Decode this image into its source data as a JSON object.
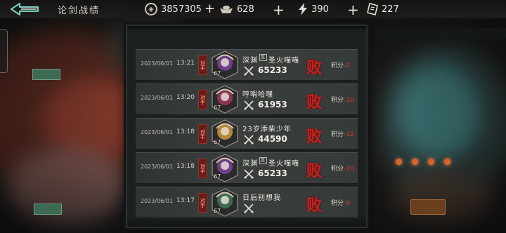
{
  "header": {
    "title": "论剑战绩",
    "resources": {
      "coins": "3857305",
      "ingots": "628",
      "energy": "390",
      "tickets": "227"
    }
  },
  "records": [
    {
      "date": "2023/06/01",
      "time": "13:21",
      "tag": "对手",
      "level": "67",
      "name": "深渊",
      "badge": "区",
      "name_suffix": "圣火喵喵",
      "power": "65233",
      "result": "败",
      "score_label": "积分",
      "score_delta": "-2",
      "avatar_color": "#6f3f8a"
    },
    {
      "date": "2023/06/01",
      "time": "13:20",
      "tag": "对手",
      "level": "67",
      "name": "哼哨哈嘿",
      "badge": "",
      "name_suffix": "",
      "power": "61953",
      "result": "败",
      "score_label": "积分",
      "score_delta": "-10",
      "avatar_color": "#8a3454"
    },
    {
      "date": "2023/06/01",
      "time": "13:18",
      "tag": "对手",
      "level": "67",
      "name": "23岁添柴少年",
      "badge": "",
      "name_suffix": "",
      "power": "44590",
      "result": "败",
      "score_label": "积分",
      "score_delta": "-12",
      "avatar_color": "#b2893a"
    },
    {
      "date": "2023/06/01",
      "time": "13:18",
      "tag": "对手",
      "level": "67",
      "name": "深渊",
      "badge": "区",
      "name_suffix": "圣火喵喵",
      "power": "65233",
      "result": "败",
      "score_label": "积分",
      "score_delta": "-10",
      "avatar_color": "#6f3f8a"
    },
    {
      "date": "2023/06/01",
      "time": "13:17",
      "tag": "对手",
      "level": "67",
      "name": "日后别想我",
      "badge": "",
      "name_suffix": "",
      "power": "",
      "result": "败",
      "score_label": "积分",
      "score_delta": "-9",
      "avatar_color": "#3d6a55"
    }
  ]
}
